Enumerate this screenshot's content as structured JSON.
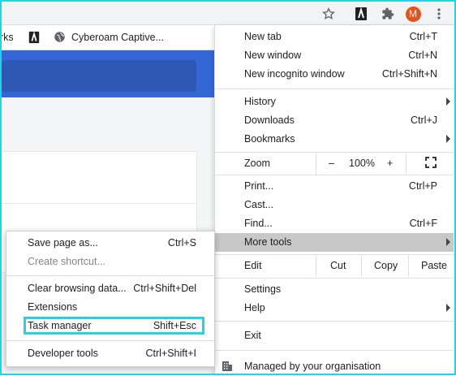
{
  "toolbar": {
    "avatar_letter": "M",
    "icons": [
      "star-icon",
      "extension-app-icon",
      "puzzle-extensions-icon",
      "avatar",
      "kebab-menu-icon"
    ]
  },
  "bookmarks": {
    "partial_label": "rks",
    "item1_icon": "bookmark-app-icon",
    "item2_label": "Cyberoam Captive...",
    "item2_icon": "globe-icon"
  },
  "menu": {
    "new_tab": "New tab",
    "new_tab_sc": "Ctrl+T",
    "new_window": "New window",
    "new_window_sc": "Ctrl+N",
    "incognito": "New incognito window",
    "incognito_sc": "Ctrl+Shift+N",
    "history": "History",
    "downloads": "Downloads",
    "downloads_sc": "Ctrl+J",
    "bookmarks": "Bookmarks",
    "zoom": "Zoom",
    "zoom_minus": "–",
    "zoom_level": "100%",
    "zoom_plus": "+",
    "print": "Print...",
    "print_sc": "Ctrl+P",
    "cast": "Cast...",
    "find": "Find...",
    "find_sc": "Ctrl+F",
    "more_tools": "More tools",
    "edit": "Edit",
    "cut": "Cut",
    "copy": "Copy",
    "paste": "Paste",
    "settings": "Settings",
    "help": "Help",
    "exit": "Exit",
    "managed": "Managed by your organisation"
  },
  "submenu": {
    "save_page": "Save page as...",
    "save_page_sc": "Ctrl+S",
    "create_shortcut": "Create shortcut...",
    "clear_data": "Clear browsing data...",
    "clear_data_sc": "Ctrl+Shift+Del",
    "extensions": "Extensions",
    "task_manager": "Task manager",
    "task_manager_sc": "Shift+Esc",
    "dev_tools": "Developer tools",
    "dev_tools_sc": "Ctrl+Shift+I"
  },
  "colors": {
    "highlight": "#22d3e6",
    "avatar": "#e8501e",
    "hover": "#c8c8c8",
    "header_blue": "#3367d6"
  }
}
